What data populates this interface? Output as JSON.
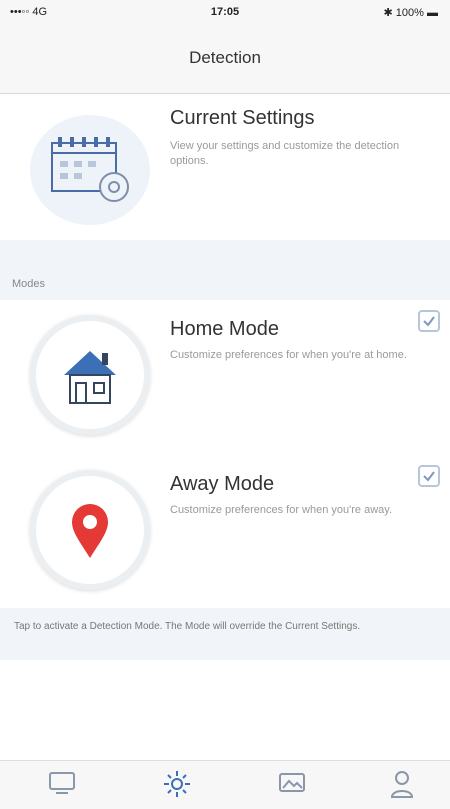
{
  "status_bar": {
    "carrier": "•••◦◦ 4G",
    "time": "17:05",
    "battery": "✱ 100% ▬"
  },
  "nav": {
    "title": "Detection"
  },
  "current_settings": {
    "title": "Current Settings",
    "description": "View your settings and customize the detection options."
  },
  "modes": {
    "section_label": "Modes",
    "home": {
      "title": "Home Mode",
      "description": "Customize preferences for when you're at home."
    },
    "away": {
      "title": "Away Mode",
      "description": "Customize preferences for when you're away."
    }
  },
  "footer": {
    "note": "Tap to activate a Detection Mode. The Mode will override the Current Settings."
  },
  "colors": {
    "accent": "#3b6fb6",
    "pin": "#e53935",
    "band": "#f1f4f8"
  },
  "tabs": [
    "monitor-icon",
    "detection-sun-icon",
    "photos-icon",
    "profile-icon"
  ]
}
